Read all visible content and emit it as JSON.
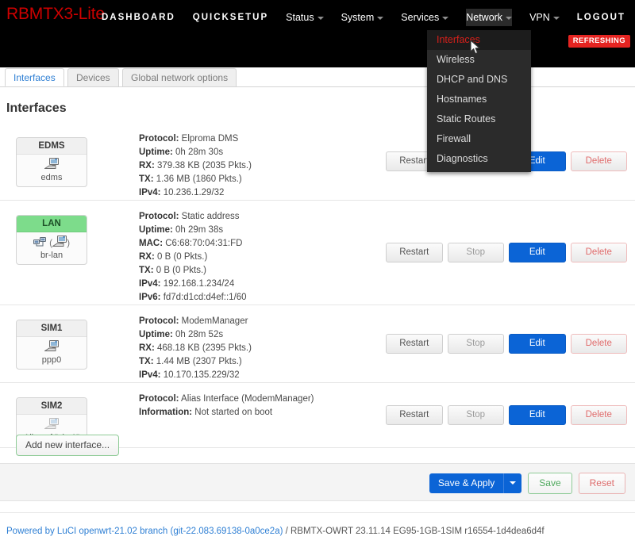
{
  "header": {
    "brand": "RBMTX3-Lite",
    "menu": [
      {
        "label": "DASHBOARD",
        "caps": true,
        "caret": false
      },
      {
        "label": "QUICKSETUP",
        "caps": true,
        "caret": false
      },
      {
        "label": "Status",
        "caps": false,
        "caret": true
      },
      {
        "label": "System",
        "caps": false,
        "caret": true
      },
      {
        "label": "Services",
        "caps": false,
        "caret": true
      },
      {
        "label": "Network",
        "caps": false,
        "caret": true
      },
      {
        "label": "VPN",
        "caps": false,
        "caret": true
      },
      {
        "label": "LOGOUT",
        "caps": true,
        "caret": false
      }
    ],
    "status_badge": "REFRESHING",
    "status_badge_color": "#e52421",
    "brand_color": "#cc0000"
  },
  "network_dropdown": {
    "open": true,
    "items": [
      {
        "label": "Interfaces",
        "active": true
      },
      {
        "label": "Wireless",
        "active": false
      },
      {
        "label": "DHCP and DNS",
        "active": false
      },
      {
        "label": "Hostnames",
        "active": false
      },
      {
        "label": "Static Routes",
        "active": false
      },
      {
        "label": "Firewall",
        "active": false
      },
      {
        "label": "Diagnostics",
        "active": false
      }
    ]
  },
  "tabs": [
    {
      "label": "Interfaces",
      "active": true
    },
    {
      "label": "Devices",
      "active": false
    },
    {
      "label": "Global network options",
      "active": false
    }
  ],
  "page": {
    "title": "Interfaces"
  },
  "buttons": {
    "restart": "Restart",
    "stop": "Stop",
    "edit": "Edit",
    "delete": "Delete",
    "add_interface": "Add new interface...",
    "save_apply": "Save & Apply",
    "save": "Save",
    "reset": "Reset"
  },
  "labels": {
    "protocol": "Protocol:",
    "uptime": "Uptime:",
    "mac": "MAC:",
    "rx": "RX:",
    "tx": "TX:",
    "ipv4": "IPv4:",
    "ipv6": "IPv6:",
    "information": "Information:"
  },
  "interfaces": [
    {
      "name": "EDMS",
      "device": "edms",
      "up": false,
      "alias": false,
      "fields": [
        {
          "label": "Protocol:",
          "value": "Elproma DMS"
        },
        {
          "label": "Uptime:",
          "value": "0h 28m 30s"
        },
        {
          "label": "RX:",
          "value": "379.38 KB (2035 Pkts.)"
        },
        {
          "label": "TX:",
          "value": "1.36 MB (1860 Pkts.)"
        },
        {
          "label": "IPv4:",
          "value": "10.236.1.29/32"
        }
      ]
    },
    {
      "name": "LAN",
      "device": "br-lan",
      "up": true,
      "alias": false,
      "fields": [
        {
          "label": "Protocol:",
          "value": "Static address"
        },
        {
          "label": "Uptime:",
          "value": "0h 29m 38s"
        },
        {
          "label": "MAC:",
          "value": "C6:68:70:04:31:FD"
        },
        {
          "label": "RX:",
          "value": "0 B (0 Pkts.)"
        },
        {
          "label": "TX:",
          "value": "0 B (0 Pkts.)"
        },
        {
          "label": "IPv4:",
          "value": "192.168.1.234/24"
        },
        {
          "label": "IPv6:",
          "value": "fd7d:d1cd:d4ef::1/60"
        }
      ]
    },
    {
      "name": "SIM1",
      "device": "ppp0",
      "up": false,
      "alias": false,
      "fields": [
        {
          "label": "Protocol:",
          "value": "ModemManager"
        },
        {
          "label": "Uptime:",
          "value": "0h 28m 52s"
        },
        {
          "label": "RX:",
          "value": "468.18 KB (2395 Pkts.)"
        },
        {
          "label": "TX:",
          "value": "1.44 MB (2307 Pkts.)"
        },
        {
          "label": "IPv4:",
          "value": "10.170.135.229/32"
        }
      ]
    },
    {
      "name": "SIM2",
      "device": "Alias of \"sim1\"",
      "up": false,
      "alias": true,
      "fields": [
        {
          "label": "Protocol:",
          "value": "Alias Interface (ModemManager)"
        },
        {
          "label": "Information:",
          "value": "Not started on boot"
        }
      ]
    }
  ],
  "footer": {
    "link": "Powered by LuCI openwrt-21.02 branch (git-22.083.69138-0a0ce2a)",
    "text": " / RBMTX-OWRT 23.11.14 EG95-1GB-1SIM r16554-1d4dea6d4f"
  },
  "icons": {
    "ethernet": "ethernet-icon",
    "bridge": "bridge-icon",
    "cursor": "mouse-cursor-icon",
    "caret": "chevron-down-icon"
  }
}
